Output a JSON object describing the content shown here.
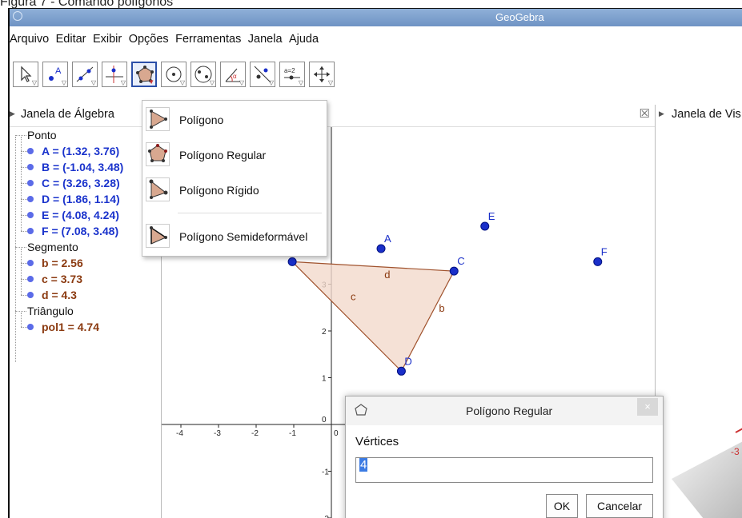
{
  "caption": "Figura 7 - Comando polígonos",
  "window": {
    "title": "GeoGebra"
  },
  "menu": [
    "Arquivo",
    "Editar",
    "Exibir",
    "Opções",
    "Ferramentas",
    "Janela",
    "Ajuda"
  ],
  "tools": [
    "move-tool",
    "point-tool",
    "line-tool",
    "perpendicular-tool",
    "polygon-tool",
    "circle-tool",
    "conic-tool",
    "angle-tool",
    "reflect-tool",
    "slider-tool",
    "move-view-tool"
  ],
  "algebra": {
    "title": "Janela de Álgebra",
    "categories": [
      {
        "label": "Ponto",
        "items": [
          "A = (1.32, 3.76)",
          "B = (-1.04, 3.48)",
          "C = (3.26, 3.28)",
          "D = (1.86, 1.14)",
          "E = (4.08, 4.24)",
          "F = (7.08, 3.48)"
        ],
        "color": "#1a33cc"
      },
      {
        "label": "Segmento",
        "items": [
          "b = 2.56",
          "c = 3.73",
          "d = 4.3"
        ],
        "color": "#8b3a10"
      },
      {
        "label": "Triângulo",
        "items": [
          "pol1 = 4.74"
        ],
        "color": "#8b3a10"
      }
    ]
  },
  "graphics": {
    "points": [
      {
        "name": "A",
        "x": 1.32,
        "y": 3.76
      },
      {
        "name": "B",
        "x": -1.04,
        "y": 3.48
      },
      {
        "name": "C",
        "x": 3.26,
        "y": 3.28
      },
      {
        "name": "D",
        "x": 1.86,
        "y": 1.14
      },
      {
        "name": "E",
        "x": 4.08,
        "y": 4.24
      },
      {
        "name": "F",
        "x": 7.08,
        "y": 3.48
      }
    ],
    "segments": [
      "d",
      "c",
      "b"
    ],
    "x_ticks": [
      "-4",
      "-3",
      "-2",
      "-1",
      "0"
    ],
    "y_ticks": [
      "3",
      "2",
      "1",
      "0",
      "-1",
      "-2"
    ]
  },
  "right_panel": {
    "title": "Janela de Vis"
  },
  "close_glyph": "☒",
  "polygon_menu": [
    "Polígono",
    "Polígono Regular",
    "Polígono Rígido",
    "Polígono Semideformável"
  ],
  "dialog": {
    "title": "Polígono Regular",
    "label": "Vértices",
    "value": "4",
    "ok": "OK",
    "cancel": "Cancelar",
    "close": "×"
  },
  "view3d_tick": "-3",
  "colors": {
    "point": "#1a2fc9",
    "polygon_fill": "#f3d9cc",
    "polygon_edge": "#a0522d",
    "selection": "#2b4fa8"
  }
}
